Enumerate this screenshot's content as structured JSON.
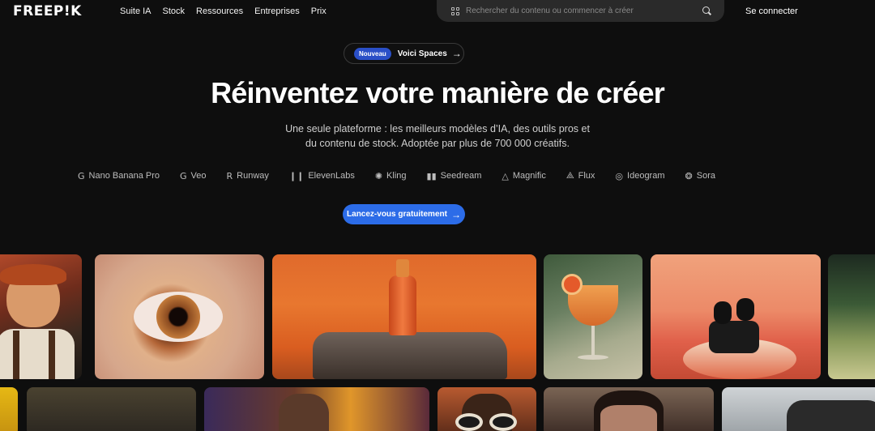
{
  "brand": {
    "logo": "FREEP!K"
  },
  "nav": {
    "items": [
      "Suite IA",
      "Stock",
      "Ressources",
      "Entreprises",
      "Prix"
    ],
    "signin": "Se connecter"
  },
  "search": {
    "placeholder": "Rechercher du contenu ou commencer à créer"
  },
  "announcement": {
    "badge": "Nouveau",
    "text": "Voici Spaces",
    "arrow": "→"
  },
  "hero": {
    "title": "Réinventez votre manière de créer",
    "subtitle_line1": "Une seule plateforme : les meilleurs modèles d’IA, des outils pros et",
    "subtitle_line2": "du contenu de stock. Adoptée par plus de 700 000 créatifs."
  },
  "models": [
    {
      "icon": "google-icon",
      "glyph": "G",
      "label": "Nano Banana Pro"
    },
    {
      "icon": "google-icon",
      "glyph": "G",
      "label": "Veo"
    },
    {
      "icon": "runway-icon",
      "glyph": "R",
      "label": "Runway"
    },
    {
      "icon": "elevenlabs-icon",
      "glyph": "❙❙",
      "label": "ElevenLabs"
    },
    {
      "icon": "kling-icon",
      "glyph": "✺",
      "label": "Kling"
    },
    {
      "icon": "seedream-icon",
      "glyph": "▮▮",
      "label": "Seedream"
    },
    {
      "icon": "magnific-icon",
      "glyph": "△",
      "label": "Magnific"
    },
    {
      "icon": "flux-icon",
      "glyph": "⟁",
      "label": "Flux"
    },
    {
      "icon": "ideogram-icon",
      "glyph": "◎",
      "label": "Ideogram"
    },
    {
      "icon": "sora-icon",
      "glyph": "❂",
      "label": "Sora"
    }
  ],
  "cta": {
    "label": "Lancez-vous gratuitement",
    "arrow": "→"
  },
  "gallery": {
    "row1": [
      "cartoon-character",
      "eye-closeup",
      "orange-bottle-on-rock",
      "cocktail-glass",
      "black-earbuds",
      "green-field"
    ],
    "row2": [
      "yellow-tile",
      "figure-silhouette",
      "warrior-explosion",
      "sunglasses-portrait",
      "man-portrait",
      "vehicle"
    ]
  },
  "colors": {
    "accent": "#2c6ce8",
    "badge": "#2a4fc7",
    "background": "#0e0e0e"
  }
}
